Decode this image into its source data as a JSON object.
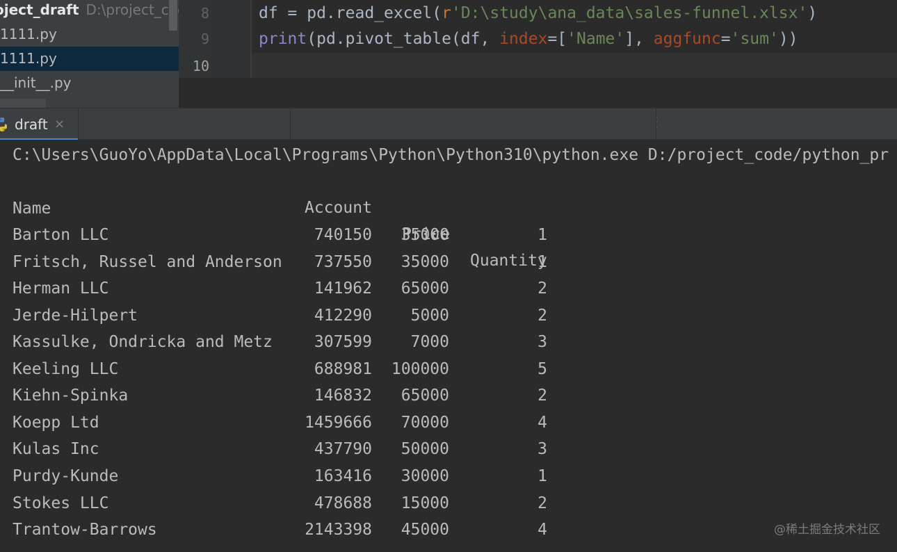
{
  "sidebar": {
    "root_name": "oject_draft",
    "root_path": "D:\\project_cod",
    "items": [
      {
        "label": "1111.py"
      },
      {
        "label": "1111.py"
      },
      {
        "label": "__init__.py"
      }
    ]
  },
  "editor": {
    "lines": [
      {
        "number": "8"
      },
      {
        "number": "9"
      },
      {
        "number": "10"
      }
    ],
    "line8": {
      "p1": "df = pd.read_excel(",
      "prefix": "r",
      "str": "'D:\\study\\ana_data\\sales-funnel.xlsx'",
      "p2": ")"
    },
    "line9": {
      "builtin": "print",
      "p1": "(pd.pivot_table(df, ",
      "param1": "index",
      "p2": "=[",
      "str1": "'Name'",
      "p3": "], ",
      "param2": "aggfunc",
      "p4": "=",
      "str2": "'sum'",
      "p5": "))"
    }
  },
  "run_tab": {
    "label": "draft",
    "close": "×"
  },
  "console": {
    "command": "C:\\Users\\GuoYo\\AppData\\Local\\Programs\\Python\\Python310\\python.exe D:/project_code/python_pr",
    "columns": {
      "account": "Account",
      "price": "Price",
      "quantity": "Quantity"
    },
    "index_name": "Name",
    "rows": [
      {
        "name": "Barton LLC",
        "account": "740150",
        "price": "35000",
        "quantity": "1"
      },
      {
        "name": "Fritsch, Russel and Anderson",
        "account": "737550",
        "price": "35000",
        "quantity": "1"
      },
      {
        "name": "Herman LLC",
        "account": "141962",
        "price": "65000",
        "quantity": "2"
      },
      {
        "name": "Jerde-Hilpert",
        "account": "412290",
        "price": "5000",
        "quantity": "2"
      },
      {
        "name": "Kassulke, Ondricka and Metz",
        "account": "307599",
        "price": "7000",
        "quantity": "3"
      },
      {
        "name": "Keeling LLC",
        "account": "688981",
        "price": "100000",
        "quantity": "5"
      },
      {
        "name": "Kiehn-Spinka",
        "account": "146832",
        "price": "65000",
        "quantity": "2"
      },
      {
        "name": "Koepp Ltd",
        "account": "1459666",
        "price": "70000",
        "quantity": "4"
      },
      {
        "name": "Kulas Inc",
        "account": "437790",
        "price": "50000",
        "quantity": "3"
      },
      {
        "name": "Purdy-Kunde",
        "account": "163416",
        "price": "30000",
        "quantity": "1"
      },
      {
        "name": "Stokes LLC",
        "account": "478688",
        "price": "15000",
        "quantity": "2"
      },
      {
        "name": "Trantow-Barrows",
        "account": "2143398",
        "price": "45000",
        "quantity": "4"
      }
    ]
  },
  "watermark": "@稀土掘金技术社区",
  "colors": {
    "accent": "#4a88c7",
    "selection": "#0d293e",
    "string": "#6a8759",
    "param": "#aa4926",
    "builtin": "#8888c6"
  },
  "icons": {
    "run_tab": "python-icon"
  }
}
